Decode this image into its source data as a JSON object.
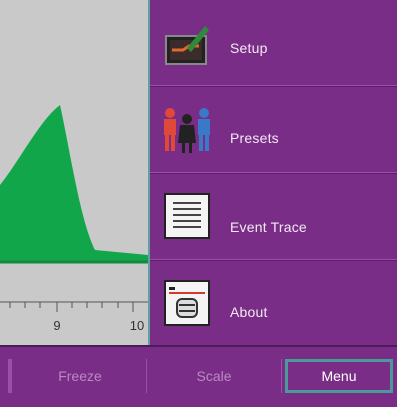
{
  "plot": {
    "tick_labels": [
      "9",
      "10"
    ],
    "curve_color": "#12a64a",
    "background": "#c9c9c9"
  },
  "menu": {
    "items": [
      {
        "label": "Setup",
        "icon": "setup-icon"
      },
      {
        "label": "Presets",
        "icon": "presets-icon"
      },
      {
        "label": "Event Trace",
        "icon": "event-trace-icon"
      },
      {
        "label": "About",
        "icon": "about-icon"
      }
    ]
  },
  "bottom": {
    "freeze": "Freeze",
    "scale": "Scale",
    "menu": "Menu"
  },
  "colors": {
    "panel": "#7a2d86",
    "active_border": "#4a9a9a"
  }
}
